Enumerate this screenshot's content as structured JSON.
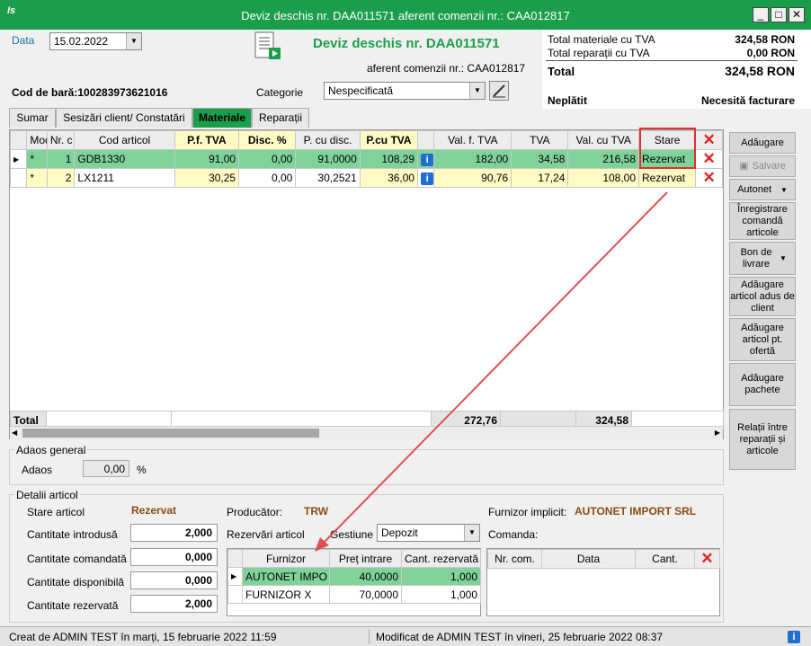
{
  "window": {
    "title": "Deviz deschis nr. DAA011571 aferent comenzii nr.: CAA012817",
    "logo": "Is",
    "min": "_",
    "max": "□",
    "close": "✕"
  },
  "header": {
    "date_label": "Data",
    "date_value": "15.02.2022",
    "doc_title": "Deviz deschis nr. DAA011571",
    "order_ref": "aferent comenzii nr.: CAA012817",
    "barcode_label": "Cod de bară:",
    "barcode_value": "100283973621016",
    "category_label": "Categorie",
    "category_value": "Nespecificată"
  },
  "totals": {
    "materials_label": "Total materiale cu TVA",
    "materials_value": "324,58 RON",
    "repairs_label": "Total reparații cu TVA",
    "repairs_value": "0,00 RON",
    "total_label": "Total",
    "total_value": "324,58 RON",
    "status_left": "Neplătit",
    "status_right": "Necesită facturare"
  },
  "tabs": [
    "Sumar",
    "Sesizări client/ Constatări",
    "Materiale",
    "Reparații"
  ],
  "grid": {
    "headers": [
      "Mod.",
      "Nr. c",
      "Cod articol",
      "P.f. TVA",
      "Disc. %",
      "P. cu disc.",
      "P.cu TVA",
      "",
      "Val. f. TVA",
      "TVA",
      "Val. cu TVA",
      "Stare"
    ],
    "rows": [
      {
        "mod": "*",
        "nr": "1",
        "cod": "GDB1330",
        "pf": "91,00",
        "disc": "0,00",
        "pdisc": "91,0000",
        "ptva": "108,29",
        "val": "182,00",
        "tva": "34,58",
        "valtva": "216,58",
        "stare": "Rezervat"
      },
      {
        "mod": "*",
        "nr": "2",
        "cod": "LX1211",
        "pf": "30,25",
        "disc": "0,00",
        "pdisc": "30,2521",
        "ptva": "36,00",
        "val": "90,76",
        "tva": "17,24",
        "valtva": "108,00",
        "stare": "Rezervat"
      }
    ],
    "total_label": "Total",
    "total_val": "272,76",
    "total_valtva": "324,58"
  },
  "side_buttons": {
    "add": "Adăugare",
    "save": "Salvare",
    "autonet": "Autonet",
    "register": "Înregistrare comandă articole",
    "bon": "Bon de livrare",
    "add_client": "Adăugare articol adus de client",
    "add_offer": "Adăugare articol pt. ofertă",
    "add_packs": "Adăugare pachete",
    "relations": "Relații între reparații și articole"
  },
  "adaos": {
    "section": "Adaos general",
    "label": "Adaos",
    "value": "0,00",
    "unit": "%"
  },
  "details": {
    "section": "Detalii articol",
    "stare_label": "Stare articol",
    "stare_value": "Rezervat",
    "producer_label": "Producător:",
    "producer_value": "TRW",
    "supplier_label": "Furnizor implicit:",
    "supplier_value": "AUTONET IMPORT SRL",
    "q_intro_label": "Cantitate introdusă",
    "q_intro": "2,000",
    "q_cmd_label": "Cantitate comandată",
    "q_cmd": "0,000",
    "q_disp_label": "Cantitate disponibilă",
    "q_disp": "0,000",
    "q_rez_label": "Cantitate rezervată",
    "q_rez": "2,000",
    "rez_label": "Rezervări articol",
    "gest_label": "Gestiune",
    "gest_value": "Depozit",
    "comanda_label": "Comanda:",
    "rez_headers": [
      "Furnizor",
      "Preț intrare",
      "Cant. rezervată"
    ],
    "rez_rows": [
      {
        "furnizor": "AUTONET IMPO",
        "pret": "40,0000",
        "cant": "1,000"
      },
      {
        "furnizor": "FURNIZOR X",
        "pret": "70,0000",
        "cant": "1,000"
      }
    ],
    "cmd_headers": [
      "Nr. com.",
      "Data",
      "Cant."
    ]
  },
  "statusbar": {
    "created": "Creat de ADMIN TEST în marți, 15 februarie 2022 11:59",
    "modified": "Modificat de ADMIN TEST în vineri, 25 februarie 2022 08:37"
  },
  "colors": {
    "accent": "#1b9e4b",
    "highlight_box": "#e03030",
    "arrow": "#e05050"
  }
}
